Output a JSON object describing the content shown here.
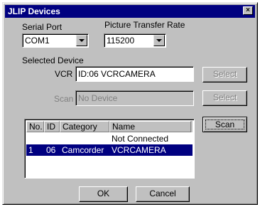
{
  "window": {
    "title": "JLIP Devices",
    "close_glyph": "×"
  },
  "serial_port": {
    "label": "Serial Port",
    "value": "COM1"
  },
  "transfer_rate": {
    "label": "Picture Transfer Rate",
    "value": "115200"
  },
  "selected_device": {
    "label": "Selected Device",
    "vcr": {
      "label": "VCR",
      "value": "ID:06 VCRCAMERA",
      "select_label": "Select"
    },
    "scan": {
      "label": "Scan",
      "value": "No Device",
      "select_label": "Select"
    }
  },
  "device_list": {
    "columns": [
      "No.",
      "ID",
      "Category",
      "Name"
    ],
    "rows": [
      {
        "no": "",
        "id": "",
        "category": "",
        "name": "Not Connected",
        "selected": false
      },
      {
        "no": "1",
        "id": "06",
        "category": "Camcorder",
        "name": "VCRCAMERA",
        "selected": true
      }
    ]
  },
  "buttons": {
    "scan": "Scan",
    "ok": "OK",
    "cancel": "Cancel"
  }
}
